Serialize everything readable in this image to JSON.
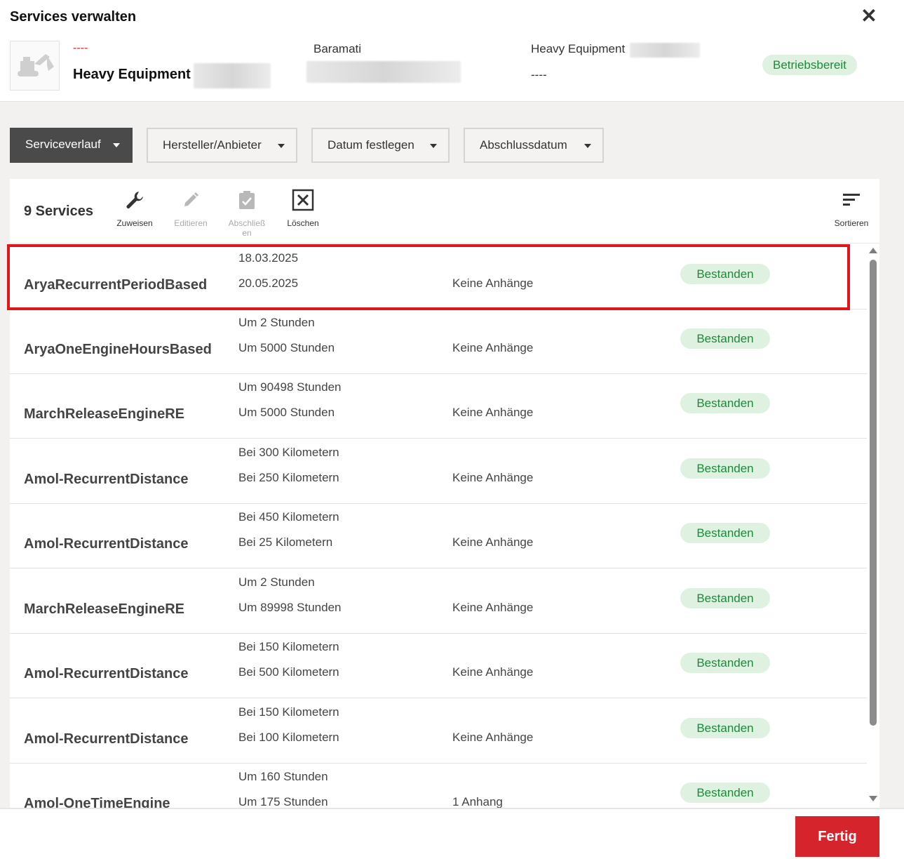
{
  "dialog": {
    "title": "Services verwalten",
    "close_glyph": "✕"
  },
  "asset": {
    "id_dashes": "----",
    "name": "Heavy Equipment",
    "location": "Baramati",
    "type_label": "Heavy Equipment",
    "type_value": "----",
    "status": "Betriebsbereit",
    "thumbnail_icon": "excavator-icon"
  },
  "filters": [
    {
      "label": "Serviceverlauf",
      "active": true
    },
    {
      "label": "Hersteller/Anbieter",
      "active": false
    },
    {
      "label": "Datum festlegen",
      "active": false
    },
    {
      "label": "Abschlussdatum",
      "active": false
    }
  ],
  "toolbar": {
    "count": "9 Services",
    "assign": {
      "label": "Zuweisen",
      "icon": "wrench-icon",
      "enabled": true
    },
    "edit": {
      "label": "Editieren",
      "icon": "pencil-icon",
      "enabled": false
    },
    "complete": {
      "label": "Abschließ en",
      "icon": "clipboard-check-icon",
      "enabled": false
    },
    "delete": {
      "label": "Löschen",
      "icon": "delete-box-icon",
      "enabled": true
    },
    "sort": {
      "label": "Sortieren",
      "icon": "sort-icon",
      "enabled": true
    }
  },
  "services": [
    {
      "name": "AryaRecurrentPeriodBased",
      "line1": "18.03.2025",
      "line2": "20.05.2025",
      "attachments": "Keine Anhänge",
      "status": "Bestanden"
    },
    {
      "name": "AryaOneEngineHoursBased",
      "line1": "Um 2 Stunden",
      "line2": "Um 5000 Stunden",
      "attachments": "Keine Anhänge",
      "status": "Bestanden"
    },
    {
      "name": "MarchReleaseEngineRE",
      "line1": "Um 90498 Stunden",
      "line2": "Um 5000 Stunden",
      "attachments": "Keine Anhänge",
      "status": "Bestanden"
    },
    {
      "name": "Amol-RecurrentDistance",
      "line1": "Bei 300 Kilometern",
      "line2": "Bei 250 Kilometern",
      "attachments": "Keine Anhänge",
      "status": "Bestanden"
    },
    {
      "name": "Amol-RecurrentDistance",
      "line1": "Bei 450 Kilometern",
      "line2": "Bei 25 Kilometern",
      "attachments": "Keine Anhänge",
      "status": "Bestanden"
    },
    {
      "name": "MarchReleaseEngineRE",
      "line1": "Um 2 Stunden",
      "line2": "Um 89998 Stunden",
      "attachments": "Keine Anhänge",
      "status": "Bestanden"
    },
    {
      "name": "Amol-RecurrentDistance",
      "line1": "Bei 150 Kilometern",
      "line2": "Bei 500 Kilometern",
      "attachments": "Keine Anhänge",
      "status": "Bestanden"
    },
    {
      "name": "Amol-RecurrentDistance",
      "line1": "Bei 150 Kilometern",
      "line2": "Bei 100 Kilometern",
      "attachments": "Keine Anhänge",
      "status": "Bestanden"
    },
    {
      "name": "Amol-OneTimeEngine",
      "line1": "Um 160 Stunden",
      "line2": "Um 175 Stunden",
      "attachments": "1 Anhang",
      "status": "Bestanden"
    }
  ],
  "footer": {
    "done_label": "Fertig"
  },
  "colors": {
    "accent_red": "#d6242c",
    "success_green": "#1d8a3a",
    "success_bg": "#dff2e1",
    "highlight": "#e0161b"
  }
}
